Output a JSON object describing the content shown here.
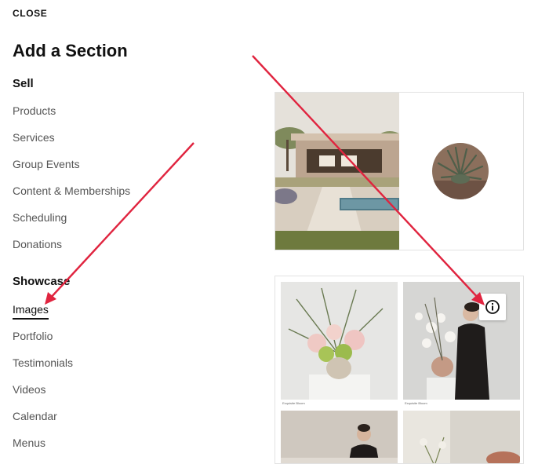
{
  "panel": {
    "close_label": "CLOSE",
    "title": "Add a Section"
  },
  "groups": {
    "sell": {
      "heading": "Sell",
      "items": [
        "Products",
        "Services",
        "Group Events",
        "Content & Memberships",
        "Scheduling",
        "Donations"
      ]
    },
    "showcase": {
      "heading": "Showcase",
      "active_item": "Images",
      "items": [
        "Images",
        "Portfolio",
        "Testimonials",
        "Videos",
        "Calendar",
        "Menus"
      ]
    }
  },
  "previews": {
    "captions": [
      "Exquisite Bloom",
      "Exquisite Bloom"
    ],
    "info_icon": "info-circle-icon"
  },
  "colors": {
    "annotation_arrow": "#e0243f",
    "text_primary": "#111111",
    "text_secondary": "#555555"
  }
}
